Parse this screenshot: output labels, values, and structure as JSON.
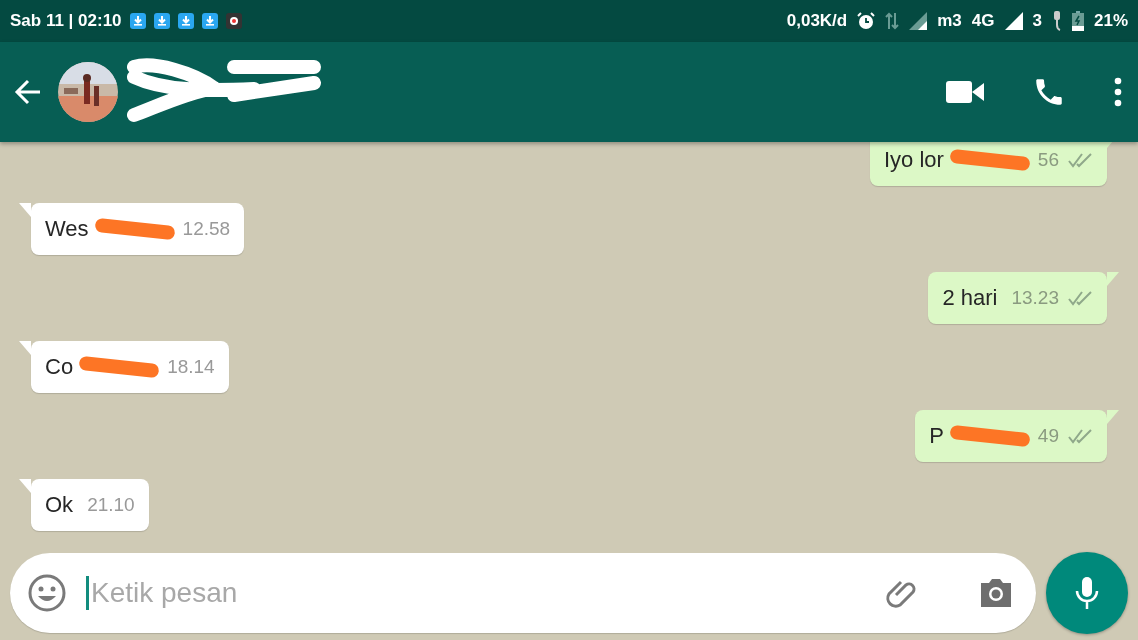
{
  "status_bar": {
    "time": "Sab 11 | 02:10",
    "speed": "0,03K/d",
    "carrier": "m3",
    "network": "4G",
    "sim_2": "3",
    "battery": "21%"
  },
  "header": {
    "redacted": true
  },
  "messages": [
    {
      "outgoing": true,
      "text": "Iyo lor",
      "redacted": true,
      "time": "56",
      "read": false
    },
    {
      "outgoing": false,
      "text": "Wes",
      "redacted": true,
      "time": "12.58"
    },
    {
      "outgoing": true,
      "text": "2 hari",
      "redacted": false,
      "time": "13.23",
      "read": false
    },
    {
      "outgoing": false,
      "text": "Co",
      "redacted": true,
      "time": "18.14"
    },
    {
      "outgoing": true,
      "text": "P",
      "redacted": true,
      "time": "49",
      "read": false
    },
    {
      "outgoing": false,
      "text": "Ok",
      "redacted": false,
      "time": "21.10"
    }
  ],
  "composer": {
    "placeholder": "Ketik pesan"
  }
}
